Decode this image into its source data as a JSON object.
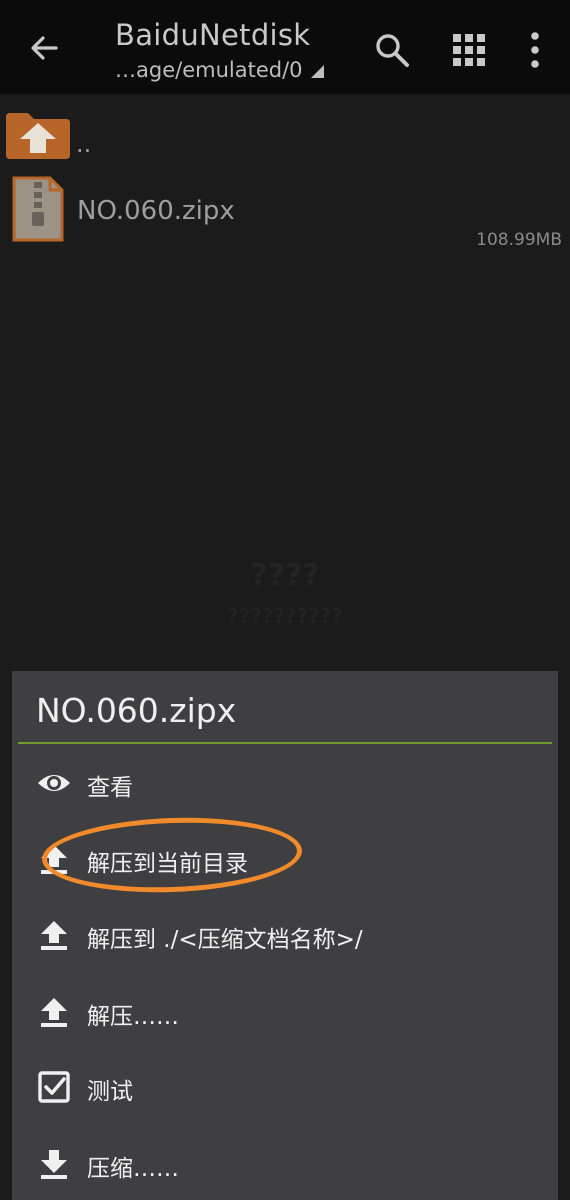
{
  "header": {
    "title": "BaiduNetdisk",
    "path": "…age/emulated/0"
  },
  "files": [
    {
      "name": "..",
      "icon": "folder-up-icon"
    },
    {
      "name": "NO.060.zipx",
      "size": "108.99MB",
      "icon": "zip-file-icon"
    }
  ],
  "watermark": {
    "line1": "????",
    "line2": "??????????"
  },
  "sheet": {
    "title": "NO.060.zipx",
    "items": [
      {
        "label": "查看",
        "icon": "eye-icon"
      },
      {
        "label": "解压到当前目录",
        "icon": "upload-icon"
      },
      {
        "label": "解压到 ./<压缩文档名称>/",
        "icon": "upload-icon"
      },
      {
        "label": "解压……",
        "icon": "upload-icon"
      },
      {
        "label": "测试",
        "icon": "checkbox-icon"
      },
      {
        "label": "压缩……",
        "icon": "download-icon"
      }
    ]
  },
  "colors": {
    "accent_divider": "#6f9d2c",
    "highlight_ring": "#f08a2a",
    "folder": "#b8652a"
  }
}
